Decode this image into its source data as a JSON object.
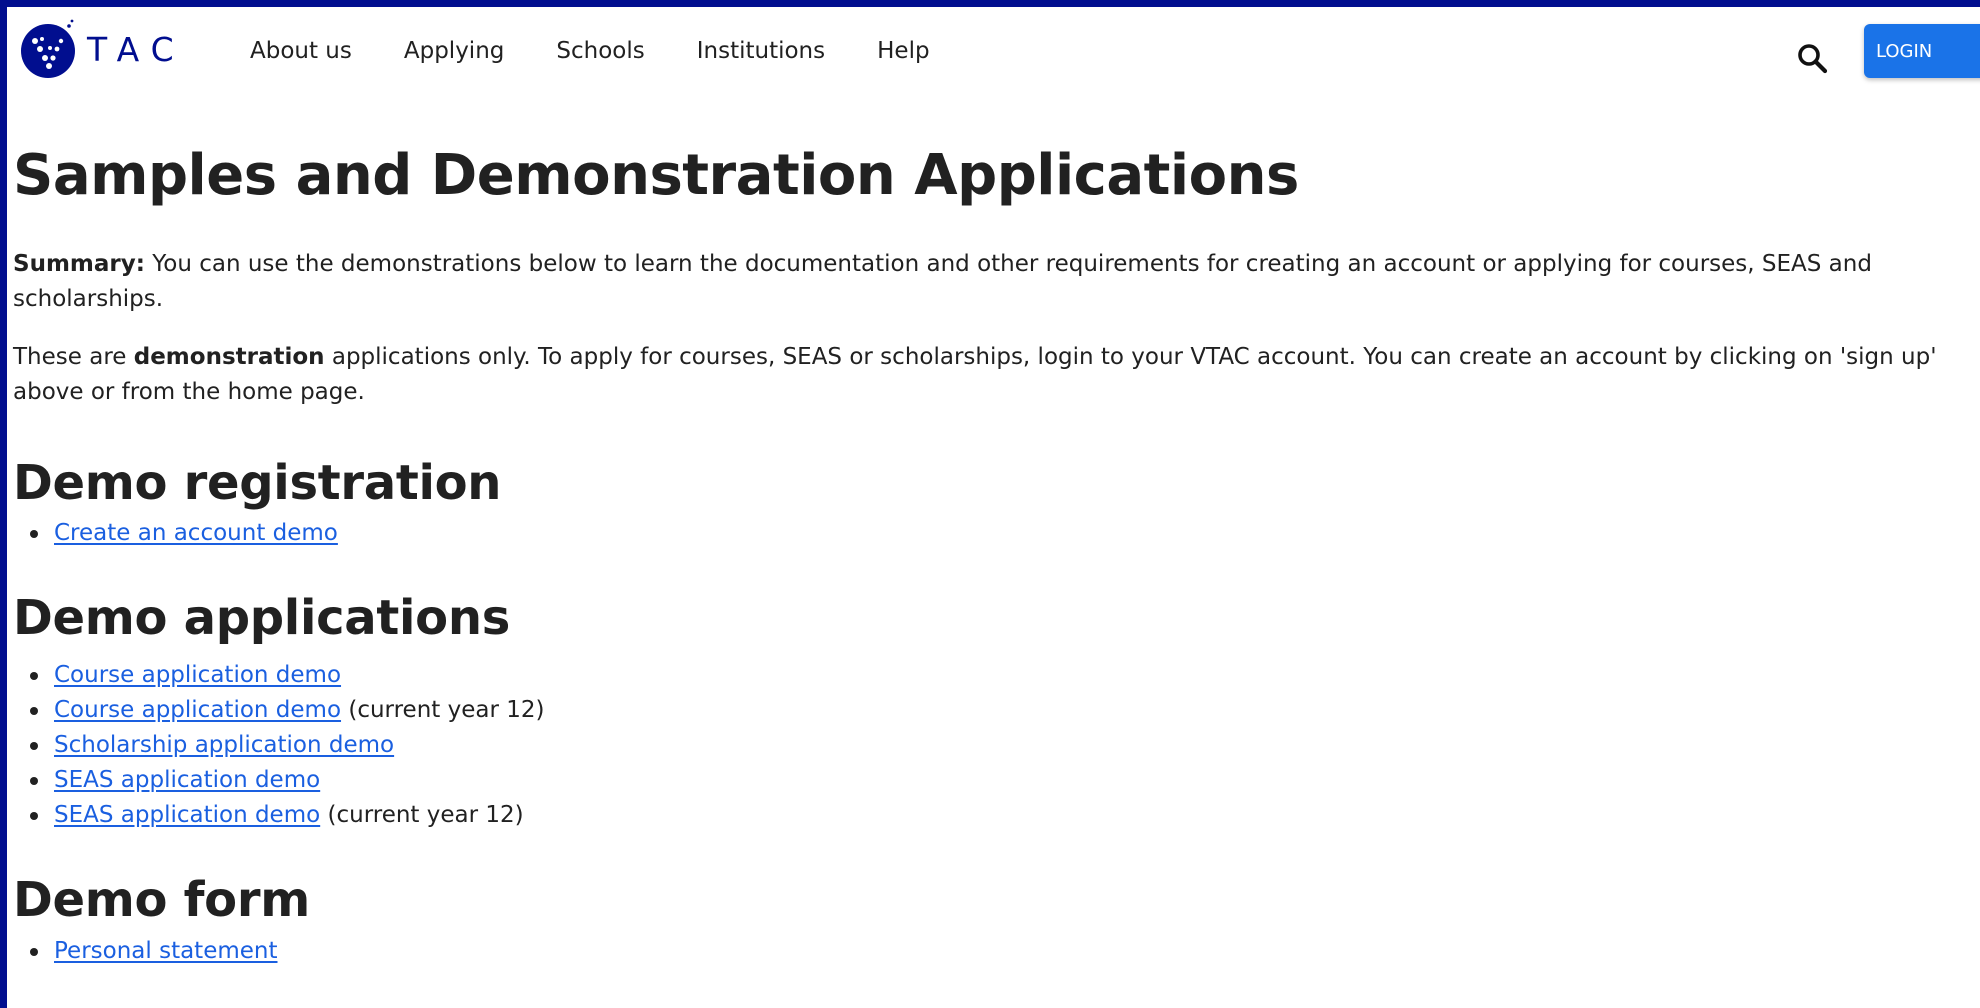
{
  "brand": {
    "logo_text": "TAC",
    "accent_color": "#010e8f",
    "button_color": "#1a73e8"
  },
  "nav": {
    "items": [
      "About us",
      "Applying",
      "Schools",
      "Institutions",
      "Help"
    ]
  },
  "header": {
    "search_icon": "search-icon",
    "login_label": "LOGIN"
  },
  "page": {
    "title": "Samples and Demonstration Applications",
    "summary_label": "Summary:",
    "summary_text": " You can use the demonstrations below to learn the documentation and other requirements for creating an account or applying for courses, SEAS and scholarships.",
    "note_before": "These are ",
    "note_bold": "demonstration",
    "note_after": " applications only. To apply for courses, SEAS or scholarships, login to your VTAC account. You can create an account by clicking on 'sign up' above or from the home page."
  },
  "sections": {
    "registration": {
      "heading": "Demo registration",
      "links": [
        {
          "label": "Create an account demo",
          "suffix": ""
        }
      ]
    },
    "applications": {
      "heading": "Demo applications",
      "links": [
        {
          "label": "Course application demo",
          "suffix": ""
        },
        {
          "label": "Course application demo",
          "suffix": " (current year 12)"
        },
        {
          "label": "Scholarship application demo",
          "suffix": ""
        },
        {
          "label": "SEAS application demo",
          "suffix": ""
        },
        {
          "label": "SEAS application demo",
          "suffix": " (current year 12)"
        }
      ]
    },
    "form": {
      "heading": "Demo form",
      "links": [
        {
          "label": "Personal statement",
          "suffix": ""
        }
      ]
    }
  }
}
